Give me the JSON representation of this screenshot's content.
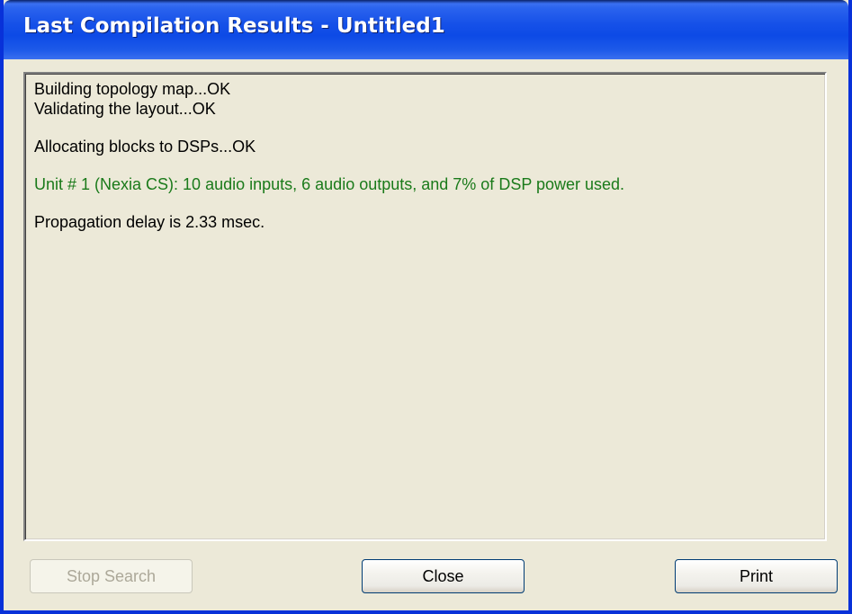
{
  "window": {
    "title": "Last Compilation Results - Untitled1"
  },
  "log": {
    "lines": [
      {
        "text": "Building topology map...OK",
        "style": "normal"
      },
      {
        "text": "Validating the layout...OK",
        "style": "normal"
      },
      {
        "text": "",
        "style": "blank"
      },
      {
        "text": "Allocating blocks to DSPs...OK",
        "style": "normal"
      },
      {
        "text": "",
        "style": "blank"
      },
      {
        "text": "Unit # 1 (Nexia CS): 10 audio inputs,  6 audio outputs, and  7% of DSP power used.",
        "style": "green"
      },
      {
        "text": "",
        "style": "blank"
      },
      {
        "text": "Propagation delay is 2.33 msec.",
        "style": "normal"
      }
    ],
    "colors": {
      "normal": "#000000",
      "green": "#1a7a1a"
    }
  },
  "buttons": {
    "stop_search_label": "Stop Search",
    "stop_search_enabled": false,
    "close_label": "Close",
    "print_label": "Print"
  },
  "colors": {
    "titlebar": "#0d4ae6",
    "face": "#ece9d8"
  }
}
